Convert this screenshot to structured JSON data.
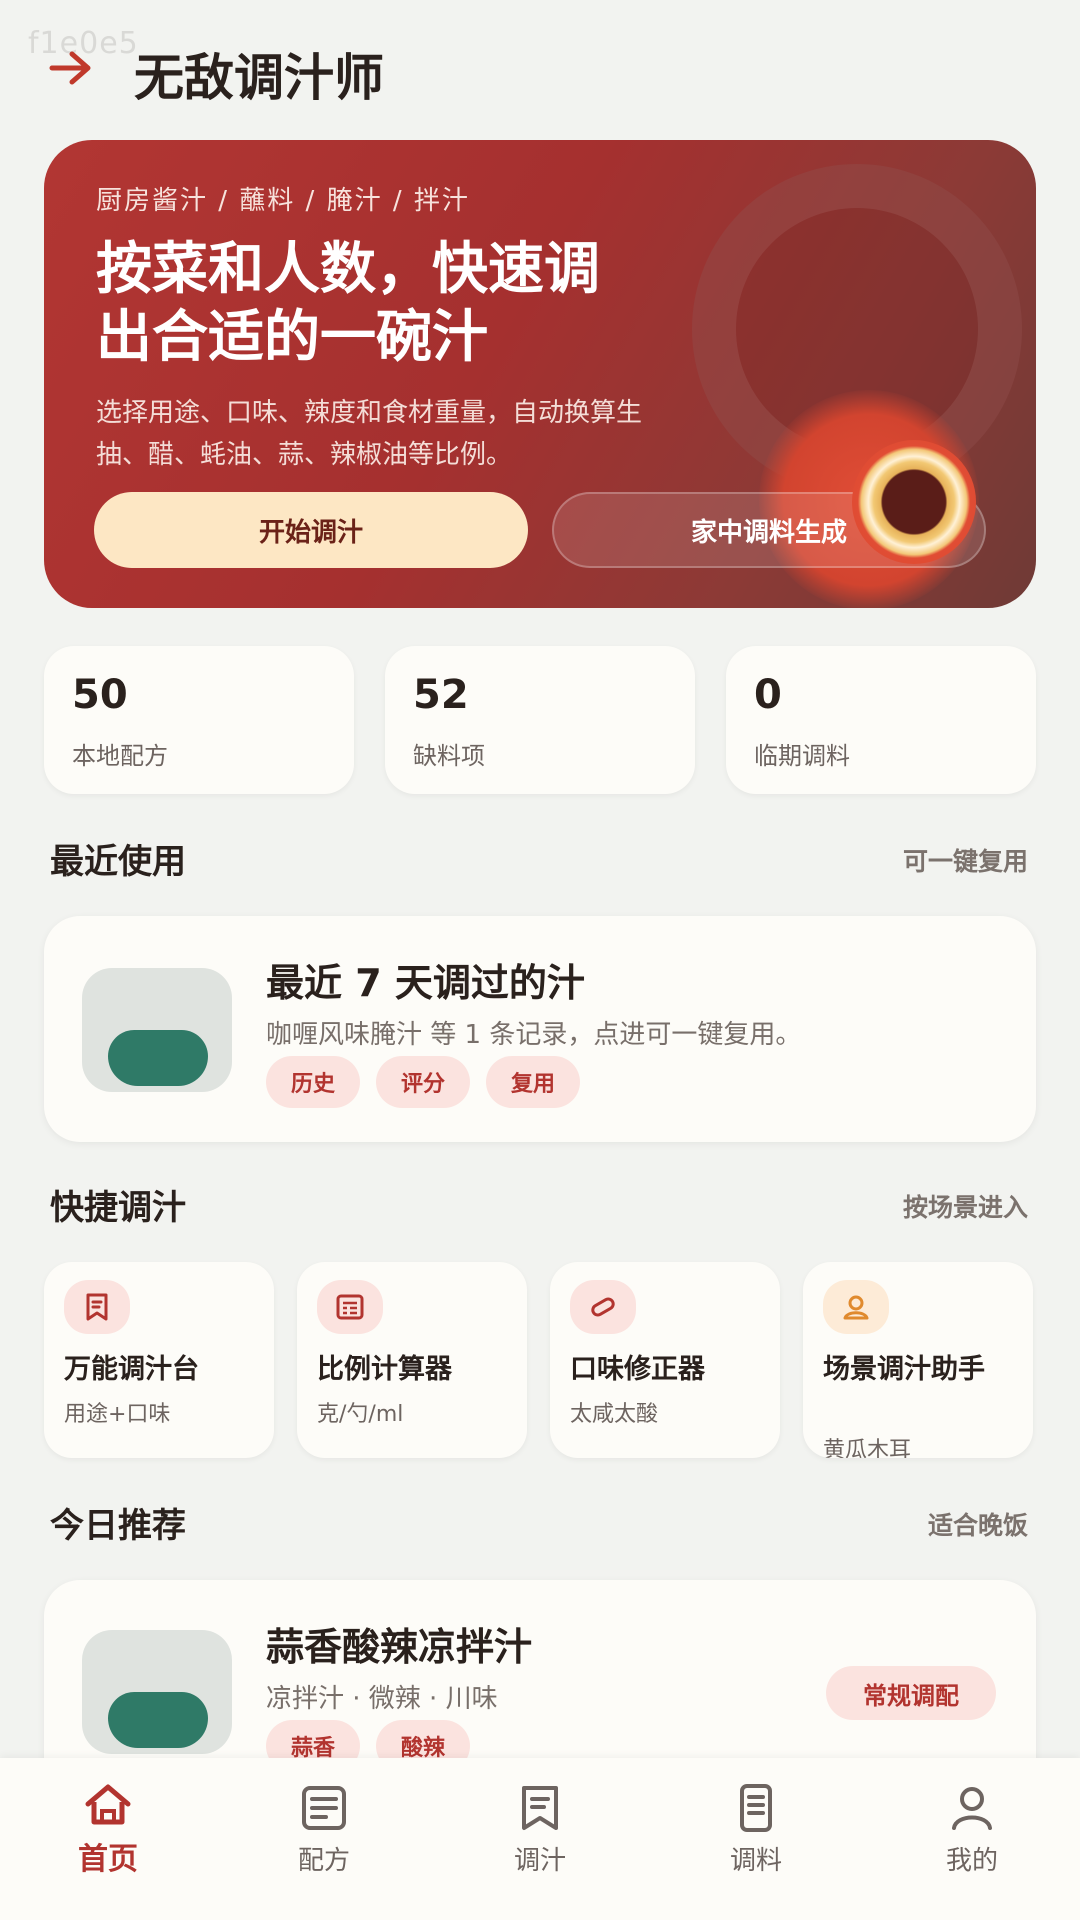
{
  "watermark": "f1e0e5",
  "header": {
    "title": "无敌调汁师"
  },
  "hero": {
    "tags": "厨房酱汁 / 蘸料 / 腌汁 / 拌汁",
    "title_line1": "按菜和人数，快速调",
    "title_line2": "出合适的一碗汁",
    "desc_line1": "选择用途、口味、辣度和食材重量，自动换算生",
    "desc_line2": "抽、醋、蚝油、蒜、辣椒油等比例。",
    "primary_button": "开始调汁",
    "secondary_button": "家中调料生成"
  },
  "stats": [
    {
      "value": "50",
      "label": "本地配方"
    },
    {
      "value": "52",
      "label": "缺料项"
    },
    {
      "value": "0",
      "label": "临期调料"
    }
  ],
  "recent": {
    "section_title": "最近使用",
    "section_link": "可一键复用",
    "card_title": "最近 7 天调过的汁",
    "card_sub": "咖喱风味腌汁 等 1 条记录，点进可一键复用。",
    "chips": [
      "历史",
      "评分",
      "复用"
    ]
  },
  "quick": {
    "section_title": "快捷调汁",
    "section_link": "按场景进入",
    "tools": [
      {
        "name": "万能调汁台",
        "desc": "用途+口味",
        "icon": "bookmark-icon"
      },
      {
        "name": "比例计算器",
        "desc": "克/勺/ml",
        "icon": "calculator-icon"
      },
      {
        "name": "口味修正器",
        "desc": "太咸太酸",
        "icon": "capsule-icon"
      },
      {
        "name": "场景调汁助手",
        "desc": "黄瓜木耳",
        "icon": "user-icon"
      }
    ]
  },
  "today": {
    "section_title": "今日推荐",
    "section_link": "适合晚饭",
    "card_title": "蒜香酸辣凉拌汁",
    "card_sub": "凉拌汁 · 微辣 · 川味",
    "badge": "常规调配",
    "chips": [
      "蒜香",
      "酸辣"
    ]
  },
  "nav": {
    "items": [
      {
        "label": "首页",
        "icon": "home-icon",
        "active": true
      },
      {
        "label": "配方",
        "icon": "document-icon"
      },
      {
        "label": "调汁",
        "icon": "bookmark-icon"
      },
      {
        "label": "调料",
        "icon": "list-icon"
      },
      {
        "label": "我的",
        "icon": "profile-icon"
      }
    ]
  },
  "colors": {
    "accent": "#b2342f",
    "hero": "#a5302f",
    "background": "#f2f3f0"
  }
}
